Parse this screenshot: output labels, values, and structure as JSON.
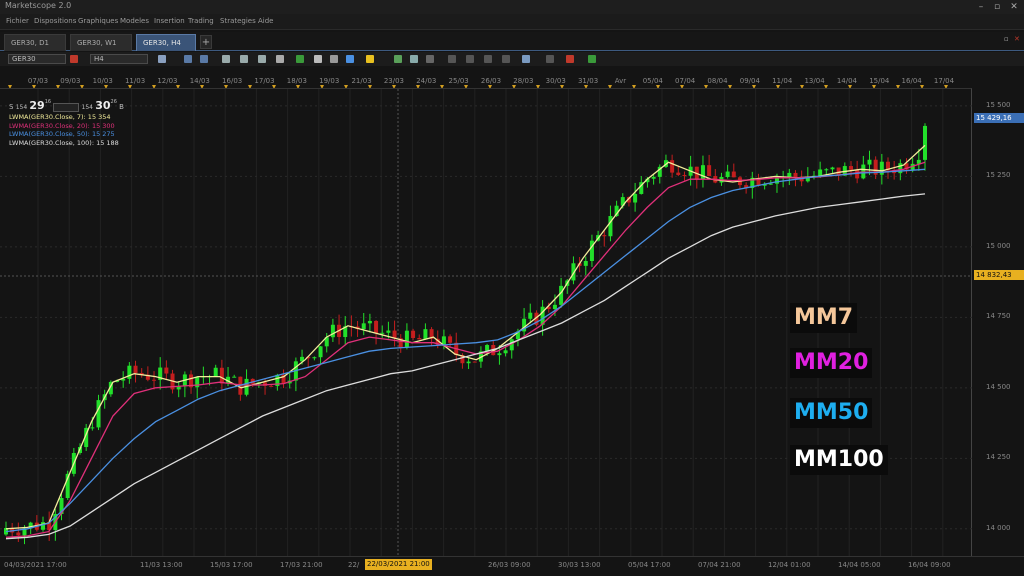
{
  "app": {
    "title": "Marketscope 2.0",
    "window_controls": [
      "–",
      "▫",
      "✕"
    ]
  },
  "menu": [
    "Fichier",
    "Dispositions",
    "Graphiques",
    "Modeles",
    "Insertion",
    "Trading",
    "Strategies",
    "Aide"
  ],
  "tabs": [
    {
      "label": "GER30, D1",
      "active": false
    },
    {
      "label": "GER30, W1",
      "active": false
    },
    {
      "label": "GER30, H4",
      "active": true
    }
  ],
  "tab_add": "+",
  "tabbar_controls": [
    "▫",
    "✕"
  ],
  "toolbar": {
    "instrument": "GER30",
    "timeframe": "H4"
  },
  "quote": {
    "sell_label": "S",
    "sell_prefix": "154",
    "sell_big": "29",
    "sell_sup": "16",
    "buy_prefix": "154",
    "buy_big": "30",
    "buy_sup": "26",
    "buy_label": "B"
  },
  "indicators": [
    {
      "text": "LWMA(GER30.Close, 7): 15 354",
      "color": "#f3ec9b"
    },
    {
      "text": "LWMA(GER30.Close, 20): 15 300",
      "color": "#e0307a"
    },
    {
      "text": "LWMA(GER30.Close, 50): 15 275",
      "color": "#4a90e2"
    },
    {
      "text": "LWMA(GER30.Close, 100): 15 188",
      "color": "#dddddd"
    }
  ],
  "date_labels": [
    "07/03",
    "09/03",
    "10/03",
    "11/03",
    "12/03",
    "14/03",
    "16/03",
    "17/03",
    "18/03",
    "19/03",
    "21/03",
    "23/03",
    "24/03",
    "25/03",
    "26/03",
    "28/03",
    "30/03",
    "31/03",
    "Avr",
    "05/04",
    "07/04",
    "08/04",
    "09/04",
    "11/04",
    "13/04",
    "14/04",
    "15/04",
    "16/04",
    "17/04"
  ],
  "price_axis": [
    "15 500",
    "15 250",
    "15 000",
    "14 750",
    "14 500",
    "14 250",
    "14 000"
  ],
  "price_tags": {
    "last": {
      "text": "15 429,16",
      "bg": "#3b6fb6",
      "color": "#ffffff"
    },
    "cursor": {
      "text": "14 832,43",
      "bg": "#e8b020",
      "color": "#111111"
    }
  },
  "time_axis": [
    "04/03/2021 17:00",
    "11/03 13:00",
    "15/03 17:00",
    "17/03 21:00",
    "22/",
    "26/03 09:00",
    "30/03 13:00",
    "05/04 17:00",
    "07/04 21:00",
    "12/04 01:00",
    "14/04 05:00",
    "16/04 09:00"
  ],
  "crosshair_time": "22/03/2021 21:00",
  "legend": [
    {
      "label": "MM7",
      "color": "#f5c79a"
    },
    {
      "label": "MM20",
      "color": "#e020e0"
    },
    {
      "label": "MM50",
      "color": "#1eaef0"
    },
    {
      "label": "MM100",
      "color": "#ffffff"
    }
  ],
  "colors": {
    "bull": "#22e02a",
    "bear": "#c41e1e",
    "background": "#141414"
  },
  "chart_data": {
    "type": "candlestick",
    "instrument": "GER30",
    "timeframe": "H4",
    "ylim": [
      13900,
      15560
    ],
    "series": [
      {
        "name": "LWMA(GER30.Close, 7)",
        "color": "#f3ec9b",
        "values": [
          14000,
          14005,
          14020,
          14200,
          14380,
          14520,
          14550,
          14540,
          14520,
          14540,
          14540,
          14500,
          14520,
          14540,
          14600,
          14680,
          14720,
          14700,
          14680,
          14660,
          14680,
          14620,
          14600,
          14640,
          14700,
          14760,
          14840,
          14960,
          15060,
          15160,
          15240,
          15300,
          15270,
          15240,
          15230,
          15240,
          15250,
          15245,
          15250,
          15265,
          15275,
          15270,
          15290,
          15360
        ]
      },
      {
        "name": "LWMA(GER30.Close, 20)",
        "color": "#e0307a",
        "values": [
          13970,
          13975,
          13990,
          14100,
          14250,
          14400,
          14480,
          14500,
          14505,
          14510,
          14520,
          14510,
          14510,
          14515,
          14540,
          14600,
          14660,
          14680,
          14670,
          14660,
          14660,
          14640,
          14620,
          14630,
          14670,
          14720,
          14790,
          14880,
          14970,
          15060,
          15140,
          15210,
          15240,
          15240,
          15235,
          15238,
          15245,
          15245,
          15248,
          15255,
          15265,
          15265,
          15275,
          15300
        ]
      },
      {
        "name": "LWMA(GER30.Close, 50)",
        "color": "#4a90e2",
        "values": [
          13990,
          14000,
          14020,
          14090,
          14170,
          14250,
          14320,
          14380,
          14420,
          14460,
          14490,
          14510,
          14530,
          14550,
          14570,
          14590,
          14610,
          14630,
          14640,
          14645,
          14650,
          14655,
          14660,
          14670,
          14700,
          14740,
          14790,
          14850,
          14910,
          14970,
          15030,
          15090,
          15140,
          15175,
          15200,
          15215,
          15230,
          15240,
          15250,
          15255,
          15262,
          15265,
          15270,
          15275
        ]
      },
      {
        "name": "LWMA(GER30.Close, 100)",
        "color": "#dddddd",
        "values": [
          13965,
          13970,
          13980,
          14010,
          14060,
          14110,
          14160,
          14200,
          14240,
          14280,
          14320,
          14360,
          14400,
          14430,
          14460,
          14490,
          14510,
          14530,
          14550,
          14560,
          14580,
          14600,
          14620,
          14640,
          14670,
          14700,
          14730,
          14770,
          14810,
          14860,
          14910,
          14960,
          15000,
          15040,
          15070,
          15090,
          15110,
          15125,
          15140,
          15150,
          15160,
          15170,
          15180,
          15188
        ]
      }
    ],
    "candles_summary": {
      "first_close": 13980,
      "high": 15460,
      "low": 13910,
      "last_close": 15429
    }
  }
}
